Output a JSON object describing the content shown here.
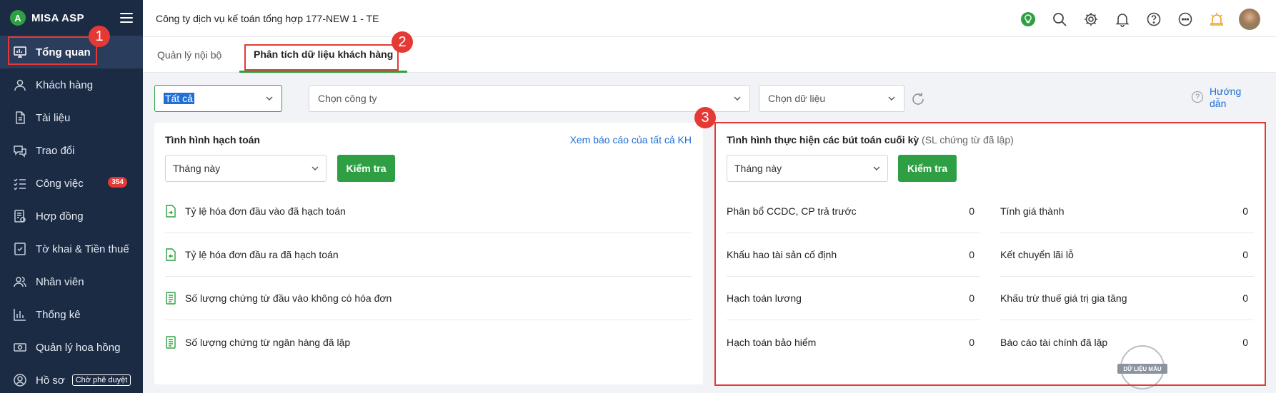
{
  "app": {
    "logo_text": "MISA ASP",
    "logo_letter": "A"
  },
  "sidebar": {
    "items": [
      {
        "label": "Tổng quan",
        "icon": "monitor-icon",
        "active": true
      },
      {
        "label": "Khách hàng",
        "icon": "user-icon"
      },
      {
        "label": "Tài liệu",
        "icon": "document-icon"
      },
      {
        "label": "Trao đổi",
        "icon": "chat-icon"
      },
      {
        "label": "Công việc",
        "icon": "checklist-icon",
        "badge": "354"
      },
      {
        "label": "Hợp đồng",
        "icon": "contract-icon"
      },
      {
        "label": "Tờ khai & Tiền thuế",
        "icon": "tax-form-icon"
      },
      {
        "label": "Nhân viên",
        "icon": "staff-icon"
      },
      {
        "label": "Thống kê",
        "icon": "statistics-icon"
      },
      {
        "label": "Quản lý hoa hồng",
        "icon": "commission-icon"
      },
      {
        "label": "Hồ sơ",
        "icon": "profile-icon",
        "status": "Chờ phê duyệt"
      }
    ]
  },
  "header": {
    "title": "Công ty dịch vụ kế toán tổng hợp 177-NEW 1 - TE",
    "icons": [
      "lightbulb-icon",
      "search-icon",
      "gear-icon",
      "bell-icon",
      "help-icon",
      "more-icon",
      "announcement-icon",
      "avatar"
    ]
  },
  "tabs": [
    {
      "label": "Quản lý nội bộ",
      "active": false
    },
    {
      "label": "Phân tích dữ liệu khách hàng",
      "active": true
    }
  ],
  "filters": {
    "group_value": "Tất cả",
    "company_placeholder": "Chọn công ty",
    "data_placeholder": "Chọn dữ liệu",
    "help_label_line1": "Hướng",
    "help_label_line2": "dẫn"
  },
  "accounting_panel": {
    "title": "Tình hình hạch toán",
    "view_all_link": "Xem báo cáo của tất cả KH",
    "period": "Tháng này",
    "check_button": "Kiểm tra",
    "rows": [
      {
        "label": "Tỷ lệ hóa đơn đầu vào đã hạch toán",
        "icon": "invoice-in-icon"
      },
      {
        "label": "Tỷ lệ hóa đơn đầu ra đã hạch toán",
        "icon": "invoice-out-icon"
      },
      {
        "label": "Số lượng chứng từ đầu vào không có hóa đơn",
        "icon": "voucher-icon"
      },
      {
        "label": "Số lượng chứng từ ngân hàng đã lập",
        "icon": "bank-voucher-icon"
      }
    ]
  },
  "closing_panel": {
    "title": "Tình hình thực hiện các bút toán cuối kỳ",
    "subtitle": "(SL chứng từ đã lập)",
    "period": "Tháng này",
    "check_button": "Kiểm tra",
    "left_rows": [
      {
        "label": "Phân bổ CCDC, CP trả trước",
        "value": "0"
      },
      {
        "label": "Khấu hao tài sản cố định",
        "value": "0"
      },
      {
        "label": "Hạch toán lương",
        "value": "0"
      },
      {
        "label": "Hạch toán bảo hiểm",
        "value": "0"
      }
    ],
    "right_rows": [
      {
        "label": "Tính giá thành",
        "value": "0"
      },
      {
        "label": "Kết chuyển lãi lỗ",
        "value": "0"
      },
      {
        "label": "Khấu trừ thuế giá trị gia tăng",
        "value": "0"
      },
      {
        "label": "Báo cáo tài chính đã lập",
        "value": "0"
      }
    ],
    "watermark": "DỮ LIỆU MẪU"
  },
  "callouts": [
    "1",
    "2",
    "3"
  ],
  "colors": {
    "sidebar_bg": "#1b2b44",
    "accent_green": "#2ea043",
    "highlight_red": "#e53935",
    "link_blue": "#1f6fd6"
  }
}
